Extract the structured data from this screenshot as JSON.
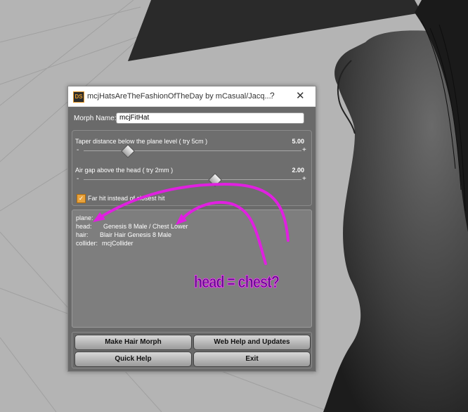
{
  "window": {
    "title": "mcjHatsAreTheFashionOfTheDay by mCasual/Jacq...",
    "help_glyph": "?",
    "close_glyph": "✕",
    "logo_text": "DS"
  },
  "morph": {
    "label": "Morph Name:",
    "value": "mcjFitHat"
  },
  "sliders": [
    {
      "label": "Taper distance below the plane level ( try 5cm )",
      "value": "5.00",
      "minus": "-",
      "plus": "+",
      "level": 0.2
    },
    {
      "label": "Air gap above the head ( try 2mm )",
      "value": "2.00",
      "minus": "-",
      "plus": "+",
      "level": 0.6
    }
  ],
  "checkbox": {
    "label": "Far hit instead of closest hit",
    "checked": true,
    "check_glyph": "✓"
  },
  "info": {
    "plane": {
      "key": "plane:",
      "value": ""
    },
    "head": {
      "key": "head:",
      "value": "Genesis 8 Male / Chest Lower"
    },
    "hair": {
      "key": "hair:",
      "value": "Blair Hair Genesis 8 Male"
    },
    "collider": {
      "key": "collider:",
      "value": "mcjCollider"
    }
  },
  "buttons": {
    "make_hair": "Make Hair Morph",
    "web_help": "Web Help and Updates",
    "quick_help": "Quick Help",
    "exit": "Exit"
  },
  "annotation": {
    "text": "head = chest?",
    "color": "#e020e0"
  }
}
